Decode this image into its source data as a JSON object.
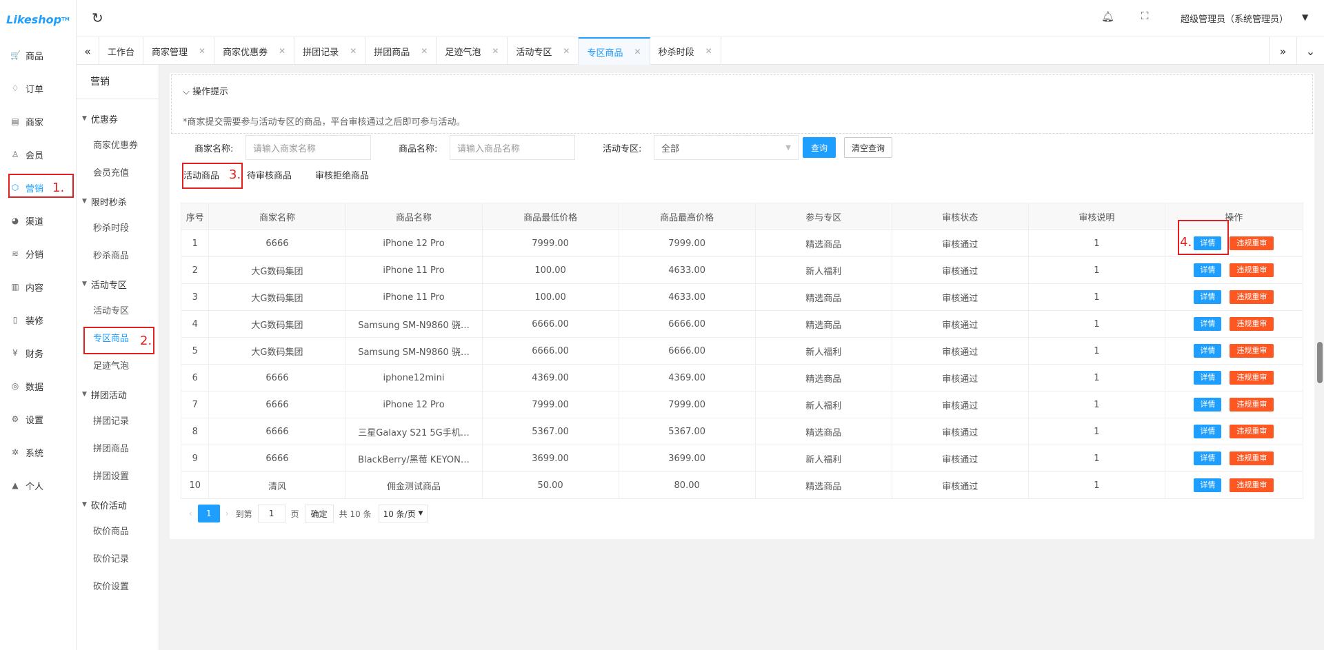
{
  "app": {
    "logo": "Likeshop",
    "logo_tm": "TM"
  },
  "nav": [
    {
      "icon": "cart-icon",
      "glyph": "🛒",
      "label": "商品"
    },
    {
      "icon": "bell-icon",
      "glyph": "♢",
      "label": "订单"
    },
    {
      "icon": "store-icon",
      "glyph": "▤",
      "label": "商家"
    },
    {
      "icon": "user-icon",
      "glyph": "♙",
      "label": "会员"
    },
    {
      "icon": "cube-icon",
      "glyph": "⬡",
      "label": "营销"
    },
    {
      "icon": "channel-icon",
      "glyph": "◕",
      "label": "渠道"
    },
    {
      "icon": "layers-icon",
      "glyph": "≋",
      "label": "分销"
    },
    {
      "icon": "book-icon",
      "glyph": "▥",
      "label": "内容"
    },
    {
      "icon": "tablet-icon",
      "glyph": "▯",
      "label": "装修"
    },
    {
      "icon": "money-icon",
      "glyph": "¥",
      "label": "财务"
    },
    {
      "icon": "globe-icon",
      "glyph": "◎",
      "label": "数据"
    },
    {
      "icon": "gear-icon",
      "glyph": "⚙",
      "label": "设置"
    },
    {
      "icon": "system-icon",
      "glyph": "✲",
      "label": "系统"
    },
    {
      "icon": "person-icon",
      "glyph": "▲",
      "label": "个人"
    }
  ],
  "annotations": {
    "a1": "1.",
    "a2": "2.",
    "a3": "3.",
    "a4": "4."
  },
  "sub": {
    "title": "营销",
    "groups": [
      {
        "label": "优惠券",
        "items": [
          "商家优惠券",
          "会员充值"
        ]
      },
      {
        "label": "限时秒杀",
        "items": [
          "秒杀时段",
          "秒杀商品"
        ]
      },
      {
        "label": "活动专区",
        "items": [
          "活动专区",
          "专区商品",
          "足迹气泡"
        ]
      },
      {
        "label": "拼团活动",
        "items": [
          "拼团记录",
          "拼团商品",
          "拼团设置"
        ]
      },
      {
        "label": "砍价活动",
        "items": [
          "砍价商品",
          "砍价记录",
          "砍价设置"
        ]
      }
    ]
  },
  "topbar": {
    "user": "超级管理员（系统管理员）"
  },
  "tabs": [
    {
      "label": "工作台",
      "close": false
    },
    {
      "label": "商家管理",
      "close": true
    },
    {
      "label": "商家优惠券",
      "close": true
    },
    {
      "label": "拼团记录",
      "close": true
    },
    {
      "label": "拼团商品",
      "close": true
    },
    {
      "label": "足迹气泡",
      "close": true
    },
    {
      "label": "活动专区",
      "close": true
    },
    {
      "label": "专区商品",
      "close": true
    },
    {
      "label": "秒杀时段",
      "close": true
    }
  ],
  "tips": {
    "header": "操作提示",
    "text": "*商家提交需要参与活动专区的商品，平台审核通过之后即可参与活动。"
  },
  "filters": {
    "shop_label": "商家名称:",
    "shop_placeholder": "请输入商家名称",
    "goods_label": "商品名称:",
    "goods_placeholder": "请输入商品名称",
    "area_label": "活动专区:",
    "area_value": "全部",
    "query": "查询",
    "clear": "清空查询"
  },
  "subtabs": [
    "活动商品",
    "待审核商品",
    "审核拒绝商品"
  ],
  "table": {
    "headers": [
      "序号",
      "商家名称",
      "商品名称",
      "商品最低价格",
      "商品最高价格",
      "参与专区",
      "审核状态",
      "审核说明",
      "操作"
    ],
    "detail": "详情",
    "violate": "违规重审",
    "rows": [
      [
        "1",
        "6666",
        "iPhone 12 Pro",
        "7999.00",
        "7999.00",
        "精选商品",
        "审核通过",
        "1"
      ],
      [
        "2",
        "大G数码集团",
        "iPhone 11 Pro",
        "100.00",
        "4633.00",
        "新人福利",
        "审核通过",
        "1"
      ],
      [
        "3",
        "大G数码集团",
        "iPhone 11 Pro",
        "100.00",
        "4633.00",
        "精选商品",
        "审核通过",
        "1"
      ],
      [
        "4",
        "大G数码集团",
        "Samsung SM-N9860 骁…",
        "6666.00",
        "6666.00",
        "精选商品",
        "审核通过",
        "1"
      ],
      [
        "5",
        "大G数码集团",
        "Samsung SM-N9860 骁…",
        "6666.00",
        "6666.00",
        "新人福利",
        "审核通过",
        "1"
      ],
      [
        "6",
        "6666",
        "iphone12mini",
        "4369.00",
        "4369.00",
        "精选商品",
        "审核通过",
        "1"
      ],
      [
        "7",
        "6666",
        "iPhone 12 Pro",
        "7999.00",
        "7999.00",
        "新人福利",
        "审核通过",
        "1"
      ],
      [
        "8",
        "6666",
        "三星Galaxy S21 5G手机…",
        "5367.00",
        "5367.00",
        "精选商品",
        "审核通过",
        "1"
      ],
      [
        "9",
        "6666",
        "BlackBerry/黑莓 KEYON…",
        "3699.00",
        "3699.00",
        "新人福利",
        "审核通过",
        "1"
      ],
      [
        "10",
        "清风",
        "佣金测试商品",
        "50.00",
        "80.00",
        "精选商品",
        "审核通过",
        "1"
      ]
    ]
  },
  "pager": {
    "page": "1",
    "goto": "到第",
    "input": "1",
    "unit": "页",
    "confirm": "确定",
    "total": "共 10 条",
    "size": "10 条/页"
  }
}
